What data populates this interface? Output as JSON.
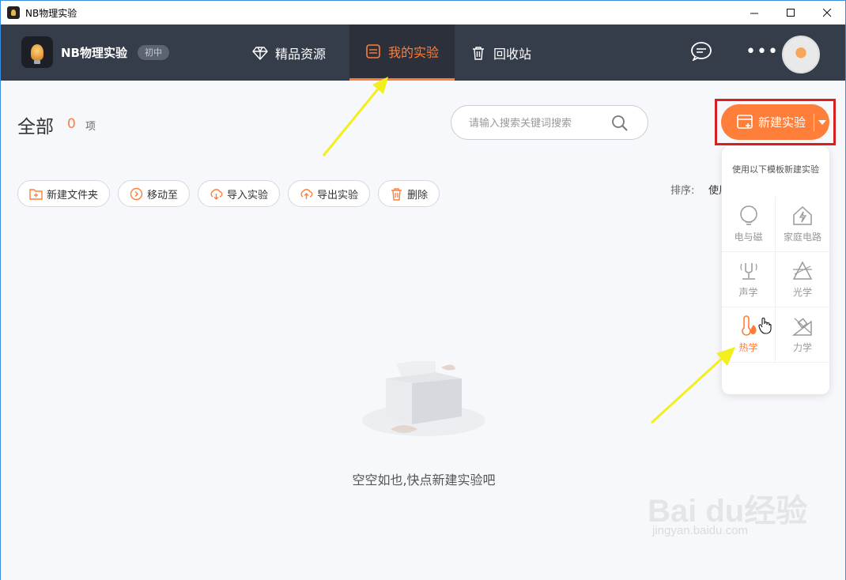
{
  "window": {
    "title": "NB物理实验"
  },
  "header": {
    "brand": "NB物理实验",
    "grade": "初中",
    "nav": [
      {
        "label": "精品资源",
        "icon": "diamond-icon"
      },
      {
        "label": "我的实验",
        "icon": "folder-icon",
        "active": true
      },
      {
        "label": "回收站",
        "icon": "trash-icon"
      }
    ],
    "chat_icon": "chat-icon",
    "more_icon": "more-icon",
    "more_label": "•••"
  },
  "main": {
    "title": "全部",
    "count": "0",
    "count_unit": "项",
    "search_placeholder": "请输入搜索关键词搜索",
    "new_button_label": "新建实验",
    "toolbar": [
      {
        "label": "新建文件夹",
        "icon": "new-folder-icon"
      },
      {
        "label": "移动至",
        "icon": "move-icon"
      },
      {
        "label": "导入实验",
        "icon": "import-icon"
      },
      {
        "label": "导出实验",
        "icon": "export-icon"
      },
      {
        "label": "删除",
        "icon": "delete-icon"
      }
    ],
    "sort_label": "排序:",
    "sort_value": "使用",
    "empty_text": "空空如也,快点新建实验吧"
  },
  "dropdown": {
    "title": "使用以下模板新建实验",
    "templates": [
      {
        "label": "电与磁",
        "icon": "bulb-icon"
      },
      {
        "label": "家庭电路",
        "icon": "house-lightning-icon"
      },
      {
        "label": "声学",
        "icon": "tuning-fork-icon"
      },
      {
        "label": "光学",
        "icon": "prism-icon"
      },
      {
        "label": "热学",
        "icon": "thermometer-flame-icon",
        "active": true
      },
      {
        "label": "力学",
        "icon": "incline-block-icon"
      }
    ]
  },
  "watermark": {
    "text": "Bai du经验",
    "sub": "jingyan.baidu.com"
  },
  "colors": {
    "accent": "#ff7e3a",
    "header_bg": "#353c4a",
    "annotation_frame": "#d72020",
    "annotation_arrow": "#f2ef1c"
  }
}
